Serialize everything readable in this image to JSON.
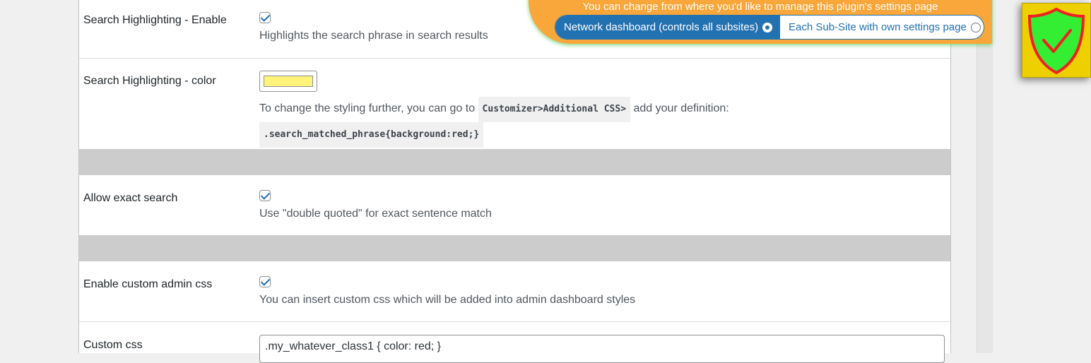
{
  "rows": {
    "highlight_enable": {
      "label": "Search Highlighting - Enable",
      "checked": true,
      "description": "Highlights the search phrase in search results"
    },
    "highlight_color": {
      "label": "Search Highlighting - color",
      "color": "#fff37a",
      "desc_before": "To change the styling further, you can go to",
      "code1": "Customizer>Additional CSS>",
      "desc_after": "add your definition:",
      "code2": ".search_matched_phrase{background:red;}"
    },
    "exact_search": {
      "label": "Allow exact search",
      "checked": true,
      "description": "Use \"double quoted\" for exact sentence match"
    },
    "custom_admin_css": {
      "label": "Enable custom admin css",
      "checked": true,
      "description": "You can insert custom css which will be added into admin dashboard styles"
    },
    "custom_css": {
      "label": "Custom css",
      "value": ".my_whatever_class1 { color: red; }"
    }
  },
  "network_panel": {
    "message": "You can change from where you'd like to manage this plugin's settings page",
    "options": [
      {
        "label": "Network dashboard (controls all subsites)",
        "selected": true
      },
      {
        "label": "Each Sub-Site with own settings page",
        "selected": false
      }
    ]
  },
  "badge": {
    "icon": "shield-check-icon",
    "colors": {
      "background": "#eed000",
      "shield": "#33ee33",
      "border": "#ee2222"
    }
  },
  "colors": {
    "accent": "#2271b1",
    "orange": "#f9a63a",
    "separator": "#cccccc"
  }
}
